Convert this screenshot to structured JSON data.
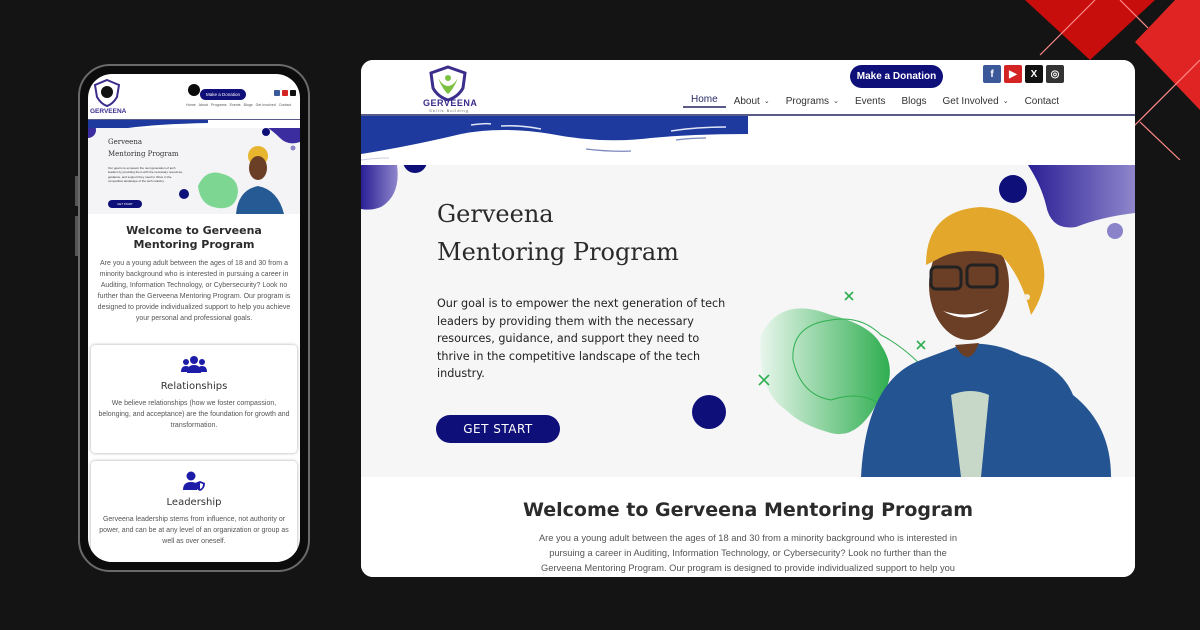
{
  "site": {
    "logo_text": "GERVEENA",
    "logo_subtitle": "Skills Building",
    "donate_label": "Make a Donation",
    "social_icons": [
      {
        "name": "facebook-icon",
        "glyph": "f"
      },
      {
        "name": "youtube-icon",
        "glyph": "▶"
      },
      {
        "name": "x-icon",
        "glyph": "X"
      },
      {
        "name": "instagram-icon",
        "glyph": "◎"
      }
    ],
    "nav": [
      {
        "label": "Home",
        "active": true,
        "dropdown": false
      },
      {
        "label": "About",
        "active": false,
        "dropdown": true
      },
      {
        "label": "Programs",
        "active": false,
        "dropdown": true
      },
      {
        "label": "Events",
        "active": false,
        "dropdown": false
      },
      {
        "label": "Blogs",
        "active": false,
        "dropdown": false
      },
      {
        "label": "Get Involved",
        "active": false,
        "dropdown": true
      },
      {
        "label": "Contact",
        "active": false,
        "dropdown": false
      }
    ],
    "mobile_nav": [
      "Home",
      "About",
      "Programs",
      "Events",
      "Blogs",
      "Get Involved",
      "Contact"
    ]
  },
  "hero": {
    "title_line1": "Gerveena",
    "title_line2": "Mentoring Program",
    "description": "Our goal is to empower the next generation of tech leaders by providing them with the necessary resources, guidance, and support they need to thrive in the competitive landscape of the tech industry.",
    "cta_label": "GET START"
  },
  "welcome": {
    "title": "Welcome to Gerveena Mentoring Program",
    "body": "Are you a young adult between the ages of 18 and 30 from a minority background who is interested in pursuing a career in Auditing, Information Technology, or Cybersecurity? Look no further than the Gerveena Mentoring Program. Our program is designed to provide individualized support to help you achieve your personal and professional goals."
  },
  "features": [
    {
      "icon": "users-icon",
      "title": "Relationships",
      "body": "We believe relationships (how we foster compassion, belonging, and acceptance) are the foundation for growth and transformation."
    },
    {
      "icon": "user-shield-icon",
      "title": "Leadership",
      "body": "Gerveena leadership stems from influence, not authority or power, and can be at any level of an organization or group as well as over oneself."
    }
  ],
  "colors": {
    "brand_navy": "#0f0f7a",
    "wave_blue": "#1e3a9e",
    "accent_red": "#e02020",
    "blob_green": "#3cb55a",
    "page_bg": "#141414"
  }
}
